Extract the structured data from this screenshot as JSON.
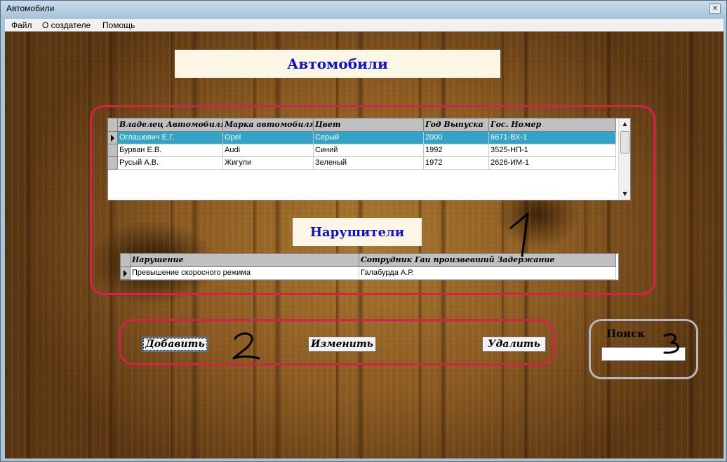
{
  "window": {
    "title": "Автомобили",
    "close_glyph": "✕"
  },
  "menu": [
    {
      "label": "Файл"
    },
    {
      "label": "О создателе"
    },
    {
      "label": "Помощь"
    }
  ],
  "cars": {
    "heading": "Автомобили",
    "columns": [
      "Владелец Автомобиля",
      "Марка автомобиля",
      "Цвет",
      "Год Выпуска",
      "Гос. Номер"
    ],
    "rows": [
      [
        "Оглашевич Е.Г.",
        "Opel",
        "Серый",
        "2000",
        "6671-ВХ-1"
      ],
      [
        "Бурван Е.В.",
        "Audi",
        "Синий",
        "1992",
        "3525-НП-1"
      ],
      [
        "Русый А.В.",
        "Жигули",
        "Зеленый",
        "1972",
        "2626-ИМ-1"
      ]
    ],
    "selected_row": 0
  },
  "violations": {
    "heading": "Нарушители",
    "columns": [
      "Нарушение",
      "Сотрудник Гаи произвевший Задержание"
    ],
    "rows": [
      [
        "Превышение скоросного  режима",
        "Галабурда А.Р."
      ]
    ]
  },
  "buttons": {
    "add": "Добавить",
    "edit": "Изменить",
    "delete": "Удалить"
  },
  "search": {
    "label": "Поиск",
    "value": ""
  },
  "annotations": {
    "one": "1",
    "two": "2",
    "three": "3"
  },
  "colors": {
    "heading_text": "#1010c8",
    "selection": "#33a3c8",
    "annotation_red": "#d8204a",
    "annotation_gray": "#b8b8b8"
  }
}
